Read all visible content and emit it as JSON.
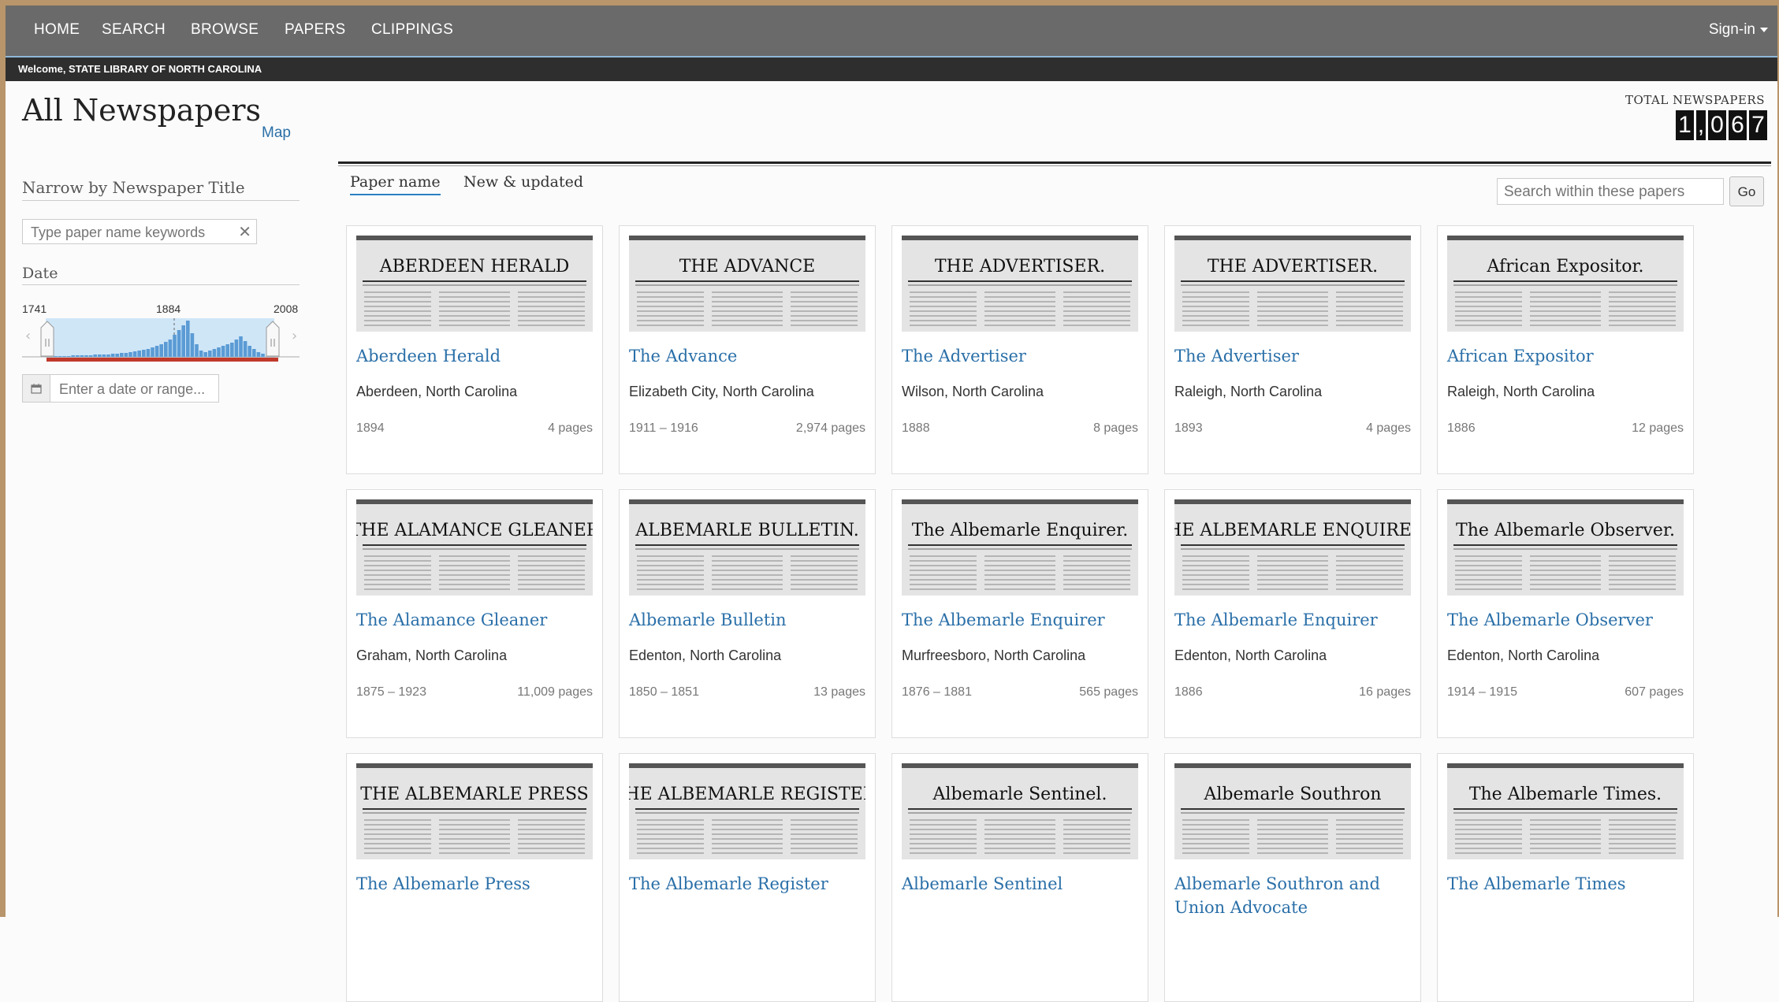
{
  "nav": {
    "items": [
      "HOME",
      "SEARCH",
      "BROWSE",
      "PAPERS",
      "CLIPPINGS"
    ],
    "signin": "Sign-in"
  },
  "welcome": "Welcome, STATE LIBRARY OF NORTH CAROLINA",
  "page": {
    "title": "All Newspapers",
    "map_link": "Map",
    "total_label": "TOTAL NEWSPAPERS",
    "total_digits": [
      "1",
      ",",
      "0",
      "6",
      "7"
    ]
  },
  "sidebar": {
    "narrow_heading": "Narrow by Newspaper Title",
    "keyword_placeholder": "Type paper name keywords",
    "date_heading": "Date",
    "date_axis": {
      "start": "1741",
      "mid": "1884",
      "end": "2008"
    },
    "date_placeholder": "Enter a date or range..."
  },
  "tabs": [
    "Paper name",
    "New & updated"
  ],
  "search": {
    "placeholder": "Search within these papers",
    "go": "Go"
  },
  "colors": {
    "nav": "#6a6a6a",
    "link": "#2a6fa8",
    "histogram": "#5b9bd5",
    "range": "#c0392b"
  },
  "papers": [
    {
      "title": "Aberdeen Herald",
      "place": "Aberdeen, North Carolina",
      "years": "1894",
      "pages": "4 pages",
      "masthead": "ABERDEEN HERALD"
    },
    {
      "title": "The Advance",
      "place": "Elizabeth City, North Carolina",
      "years": "1911 – 1916",
      "pages": "2,974 pages",
      "masthead": "THE ADVANCE"
    },
    {
      "title": "The Advertiser",
      "place": "Wilson, North Carolina",
      "years": "1888",
      "pages": "8 pages",
      "masthead": "THE ADVERTISER."
    },
    {
      "title": "The Advertiser",
      "place": "Raleigh, North Carolina",
      "years": "1893",
      "pages": "4 pages",
      "masthead": "THE ADVERTISER."
    },
    {
      "title": "African Expositor",
      "place": "Raleigh, North Carolina",
      "years": "1886",
      "pages": "12 pages",
      "masthead": "African Expositor."
    },
    {
      "title": "The Alamance Gleaner",
      "place": "Graham, North Carolina",
      "years": "1875 – 1923",
      "pages": "11,009 pages",
      "masthead": "THE ALAMANCE GLEANER"
    },
    {
      "title": "Albemarle Bulletin",
      "place": "Edenton, North Carolina",
      "years": "1850 – 1851",
      "pages": "13 pages",
      "masthead": "ALBEMARLE BULLETIN."
    },
    {
      "title": "The Albemarle Enquirer",
      "place": "Murfreesboro, North Carolina",
      "years": "1876 – 1881",
      "pages": "565 pages",
      "masthead": "The Albemarle Enquirer."
    },
    {
      "title": "The Albemarle Enquirer",
      "place": "Edenton, North Carolina",
      "years": "1886",
      "pages": "16 pages",
      "masthead": "THE ALBEMARLE ENQUIRER."
    },
    {
      "title": "The Albemarle Observer",
      "place": "Edenton, North Carolina",
      "years": "1914 – 1915",
      "pages": "607 pages",
      "masthead": "The Albemarle Observer."
    },
    {
      "title": "The Albemarle Press",
      "place": "",
      "years": "",
      "pages": "",
      "masthead": "THE ALBEMARLE PRESS"
    },
    {
      "title": "The Albemarle Register",
      "place": "",
      "years": "",
      "pages": "",
      "masthead": "THE ALBEMARLE REGISTER."
    },
    {
      "title": "Albemarle Sentinel",
      "place": "",
      "years": "",
      "pages": "",
      "masthead": "Albemarle Sentinel."
    },
    {
      "title": "Albemarle Southron and Union Advocate",
      "place": "",
      "years": "",
      "pages": "",
      "masthead": "Albemarle Southron"
    },
    {
      "title": "The Albemarle Times",
      "place": "",
      "years": "",
      "pages": "",
      "masthead": "The Albemarle Times."
    }
  ]
}
